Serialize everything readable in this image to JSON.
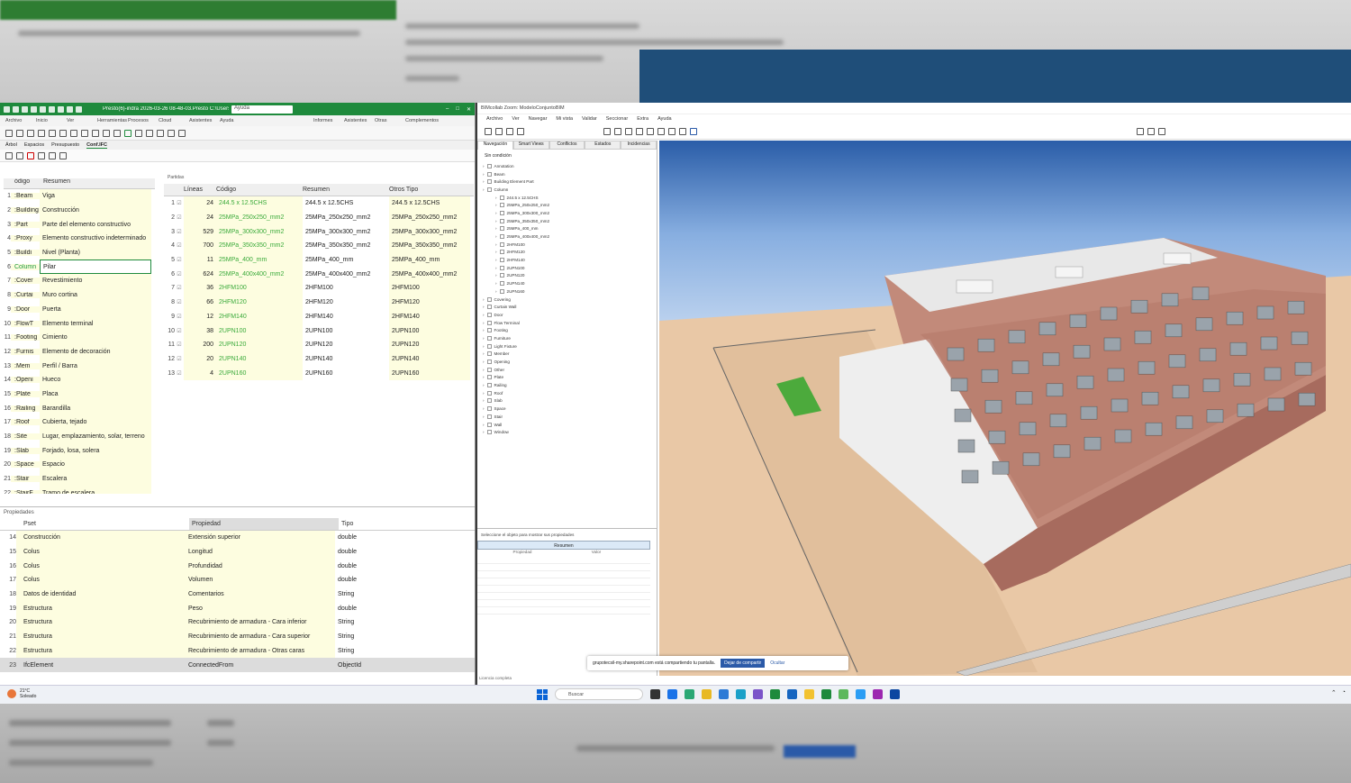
{
  "presto": {
    "title": "Presto(6)-indra 2026-03-26 08-48-03.Presto C:\\Users\\pub...",
    "search_placeholder": "Ayuda",
    "menu": [
      "Archivo",
      "Inicio",
      "Ver",
      "Herramientas",
      "Procesos",
      "Cloud",
      "Asistentes",
      "Ayuda",
      "",
      "",
      "",
      "Informes",
      "Asistentes",
      "Otras",
      "Complementos"
    ],
    "tabs": [
      "Árbol",
      "Espacios",
      "Presupuesto",
      "Conf.IFC"
    ],
    "left_table": {
      "headers": [
        "ódigo",
        "Resumen"
      ],
      "selected_index": 5,
      "rows": [
        {
          "n": "1",
          "code": ":Beam",
          "name": "Viga"
        },
        {
          "n": "2",
          "code": ":Building",
          "name": "Construcción"
        },
        {
          "n": "3",
          "code": ":Part",
          "name": "Parte del elemento constructivo"
        },
        {
          "n": "4",
          "code": ":Proxy",
          "name": "Elemento constructivo indeterminado"
        },
        {
          "n": "5",
          "code": ":Buildi",
          "name": "Nivel (Planta)"
        },
        {
          "n": "6",
          "code": "Column",
          "name": "Pilar"
        },
        {
          "n": "7",
          "code": ":Cover",
          "name": "Revestimiento"
        },
        {
          "n": "8",
          "code": ":Curtai",
          "name": "Muro cortina"
        },
        {
          "n": "9",
          "code": ":Door",
          "name": "Puerta"
        },
        {
          "n": "10",
          "code": ":FlowT",
          "name": "Elemento terminal"
        },
        {
          "n": "11",
          "code": ":Footing",
          "name": "Cimiento"
        },
        {
          "n": "12",
          "code": ":Furnis",
          "name": "Elemento de decoración"
        },
        {
          "n": "13",
          "code": ":Mem",
          "name": "Perfil / Barra"
        },
        {
          "n": "14",
          "code": ":Openi",
          "name": "Hueco"
        },
        {
          "n": "15",
          "code": ":Plate",
          "name": "Placa"
        },
        {
          "n": "16",
          "code": ":Railing",
          "name": "Barandilla"
        },
        {
          "n": "17",
          "code": ":Roof",
          "name": "Cubierta, tejado"
        },
        {
          "n": "18",
          "code": ":Site",
          "name": "Lugar, emplazamiento, solar, terreno"
        },
        {
          "n": "19",
          "code": ":Slab",
          "name": "Forjado, losa, solera"
        },
        {
          "n": "20",
          "code": ":Space",
          "name": "Espacio"
        },
        {
          "n": "21",
          "code": ":Stair",
          "name": "Escalera"
        },
        {
          "n": "22",
          "code": ":StairF",
          "name": "Tramo de escalera"
        }
      ]
    },
    "partidas": {
      "title": "Partidas",
      "headers": [
        "Líneas",
        "Código",
        "Resumen",
        "Otros Tipo"
      ],
      "rows": [
        {
          "n": "1",
          "lines": "24",
          "code": "244.5 x 12.5CHS",
          "summary": "244.5 x 12.5CHS",
          "other": "244.5 x 12.5CHS"
        },
        {
          "n": "2",
          "lines": "24",
          "code": "25MPa_250x250_mm2",
          "summary": "25MPa_250x250_mm2",
          "other": "25MPa_250x250_mm2"
        },
        {
          "n": "3",
          "lines": "529",
          "code": "25MPa_300x300_mm2",
          "summary": "25MPa_300x300_mm2",
          "other": "25MPa_300x300_mm2"
        },
        {
          "n": "4",
          "lines": "700",
          "code": "25MPa_350x350_mm2",
          "summary": "25MPa_350x350_mm2",
          "other": "25MPa_350x350_mm2"
        },
        {
          "n": "5",
          "lines": "11",
          "code": "25MPa_400_mm",
          "summary": "25MPa_400_mm",
          "other": "25MPa_400_mm"
        },
        {
          "n": "6",
          "lines": "624",
          "code": "25MPa_400x400_mm2",
          "summary": "25MPa_400x400_mm2",
          "other": "25MPa_400x400_mm2"
        },
        {
          "n": "7",
          "lines": "36",
          "code": "2HFM100",
          "summary": "2HFM100",
          "other": "2HFM100"
        },
        {
          "n": "8",
          "lines": "66",
          "code": "2HFM120",
          "summary": "2HFM120",
          "other": "2HFM120"
        },
        {
          "n": "9",
          "lines": "12",
          "code": "2HFM140",
          "summary": "2HFM140",
          "other": "2HFM140"
        },
        {
          "n": "10",
          "lines": "38",
          "code": "2UPN100",
          "summary": "2UPN100",
          "other": "2UPN100"
        },
        {
          "n": "11",
          "lines": "200",
          "code": "2UPN120",
          "summary": "2UPN120",
          "other": "2UPN120"
        },
        {
          "n": "12",
          "lines": "20",
          "code": "2UPN140",
          "summary": "2UPN140",
          "other": "2UPN140"
        },
        {
          "n": "13",
          "lines": "4",
          "code": "2UPN160",
          "summary": "2UPN160",
          "other": "2UPN160"
        }
      ]
    },
    "properties": {
      "title": "Propiedades",
      "headers": [
        "Pset",
        "Propiedad",
        "Tipo"
      ],
      "rows": [
        {
          "n": "14",
          "pset": "Construcción",
          "prop": "Extensión superior",
          "type": "double"
        },
        {
          "n": "15",
          "pset": "Colus",
          "prop": "Longitud",
          "type": "double"
        },
        {
          "n": "16",
          "pset": "Colus",
          "prop": "Profundidad",
          "type": "double"
        },
        {
          "n": "17",
          "pset": "Colus",
          "prop": "Volumen",
          "type": "double"
        },
        {
          "n": "18",
          "pset": "Datos de identidad",
          "prop": "Comentarios",
          "type": "String"
        },
        {
          "n": "19",
          "pset": "Estructura",
          "prop": "Peso",
          "type": "double"
        },
        {
          "n": "20",
          "pset": "Estructura",
          "prop": "Recubrimiento de armadura - Cara inferior",
          "type": "String"
        },
        {
          "n": "21",
          "pset": "Estructura",
          "prop": "Recubrimiento de armadura - Cara superior",
          "type": "String"
        },
        {
          "n": "22",
          "pset": "Estructura",
          "prop": "Recubrimiento de armadura - Otras caras",
          "type": "String"
        },
        {
          "n": "23",
          "pset": "IfcElement",
          "prop": "ConnectedFrom",
          "type": "ObjectId"
        }
      ]
    }
  },
  "bim": {
    "title": "BIMcollab Zoom: ModeloConjuntoBIM",
    "menu": [
      "Archivo",
      "Ver",
      "Navegar",
      "Mi vista",
      "Validar",
      "Seccionar",
      "Extra",
      "Ayuda"
    ],
    "tabs": [
      "Navegación",
      "Smart Views",
      "Conflictos",
      "Estados",
      "Incidencias"
    ],
    "tree_header": "Sin condición",
    "tree": [
      {
        "label": "Annotation",
        "sub": false
      },
      {
        "label": "Beam",
        "sub": false
      },
      {
        "label": "Building Element Part",
        "sub": false
      },
      {
        "label": "Column",
        "sub": false
      },
      {
        "label": "244.5 x 12.5CHS",
        "sub": true
      },
      {
        "label": "25MPa_250x250_mm2",
        "sub": true
      },
      {
        "label": "25MPa_300x300_mm2",
        "sub": true
      },
      {
        "label": "25MPa_350x350_mm2",
        "sub": true
      },
      {
        "label": "25MPa_400_mm",
        "sub": true
      },
      {
        "label": "25MPa_400x400_mm2",
        "sub": true
      },
      {
        "label": "2HFM100",
        "sub": true
      },
      {
        "label": "2HFM120",
        "sub": true
      },
      {
        "label": "2HFM140",
        "sub": true
      },
      {
        "label": "2UPN100",
        "sub": true
      },
      {
        "label": "2UPN120",
        "sub": true
      },
      {
        "label": "2UPN140",
        "sub": true
      },
      {
        "label": "2UPN160",
        "sub": true
      },
      {
        "label": "Covering",
        "sub": false
      },
      {
        "label": "Curtain Wall",
        "sub": false
      },
      {
        "label": "Door",
        "sub": false
      },
      {
        "label": "Flow Terminal",
        "sub": false
      },
      {
        "label": "Footing",
        "sub": false
      },
      {
        "label": "Furniture",
        "sub": false
      },
      {
        "label": "Light Fixture",
        "sub": false
      },
      {
        "label": "Member",
        "sub": false
      },
      {
        "label": "Opening",
        "sub": false
      },
      {
        "label": "Other",
        "sub": false
      },
      {
        "label": "Plate",
        "sub": false
      },
      {
        "label": "Railing",
        "sub": false
      },
      {
        "label": "Roof",
        "sub": false
      },
      {
        "label": "Slab",
        "sub": false
      },
      {
        "label": "Space",
        "sub": false
      },
      {
        "label": "Stair",
        "sub": false
      },
      {
        "label": "Wall",
        "sub": false
      },
      {
        "label": "Window",
        "sub": false
      }
    ],
    "props_message": "Seleccione el objeto para mostrar sus propiedades",
    "props_tab": "Resumen",
    "props_headers": [
      "Propiedad",
      "Valor"
    ],
    "status": "Licencia completa",
    "share_bar": {
      "text": "grupotecsil-my.sharepoint.com está compartiendo tu pantalla.",
      "stop": "Dejar de compartir",
      "hide": "Ocultar"
    }
  },
  "taskbar": {
    "temp": "21°C",
    "weather": "Soleado",
    "search": "Buscar",
    "colors": {
      "start": "#0a64d6"
    }
  }
}
